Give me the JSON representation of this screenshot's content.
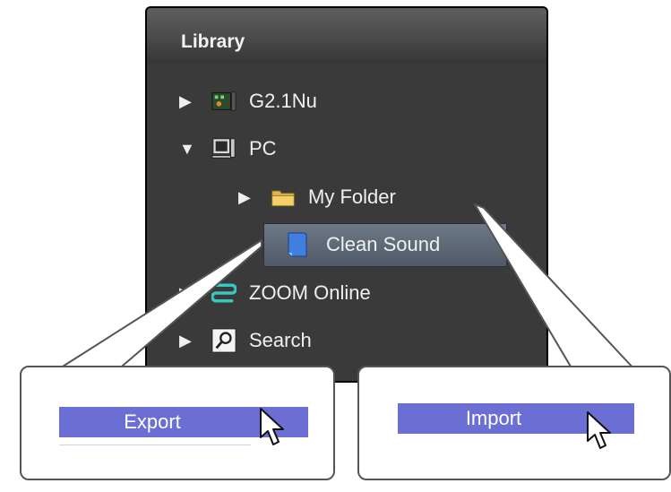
{
  "library": {
    "title": "Library",
    "items": [
      {
        "label": "G2.1Nu",
        "arrow": "▶",
        "icon": "device-icon"
      },
      {
        "label": "PC",
        "arrow": "▼",
        "icon": "computer-icon"
      },
      {
        "label": "My Folder",
        "arrow": "▶",
        "icon": "folder-icon"
      },
      {
        "label": "Clean Sound",
        "arrow": "",
        "icon": "patch-icon"
      },
      {
        "label": "ZOOM Online",
        "arrow": "▶",
        "icon": "zoom-icon"
      },
      {
        "label": "Search",
        "arrow": "▶",
        "icon": "search-icon"
      }
    ]
  },
  "context_menus": {
    "export_label": "Export",
    "import_label": "Import"
  },
  "colors": {
    "panel_bg": "#3a3a3a",
    "selection": "#5f6a78",
    "menu_highlight": "#6b6fd4"
  }
}
